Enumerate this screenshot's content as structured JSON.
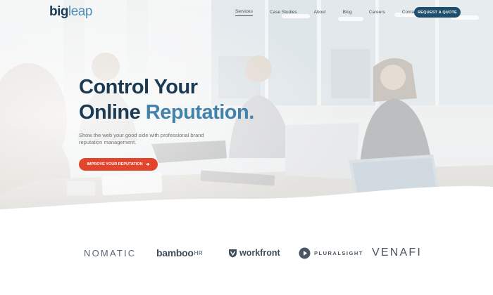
{
  "brand": {
    "logo_big": "big",
    "logo_leap": "leap"
  },
  "nav": {
    "items": [
      {
        "label": "Services",
        "active": true
      },
      {
        "label": "Case Studies"
      },
      {
        "label": "About"
      },
      {
        "label": "Blog"
      },
      {
        "label": "Careers"
      },
      {
        "label": "Contact"
      }
    ],
    "cta_label": "REQUEST A QUOTE"
  },
  "hero": {
    "title_line1": "Control Your",
    "title_line2_dark": "Online",
    "title_line2_accent": "Reputation.",
    "subtitle": "Show the web your good side with professional brand reputation management.",
    "button_label": "IMPROVE YOUR REPUTATION",
    "button_arrow": "➔"
  },
  "clients": [
    {
      "name": "NOMATIC"
    },
    {
      "name": "bamboo",
      "suffix": "HR"
    },
    {
      "name": "workfront"
    },
    {
      "name": "PLURALSIGHT"
    },
    {
      "name": "VENAFI"
    }
  ],
  "colors": {
    "navy": "#1b3b55",
    "accent_blue": "#4282ad",
    "cta_navy": "#1d4e6e",
    "cta_red": "#e2452d"
  }
}
